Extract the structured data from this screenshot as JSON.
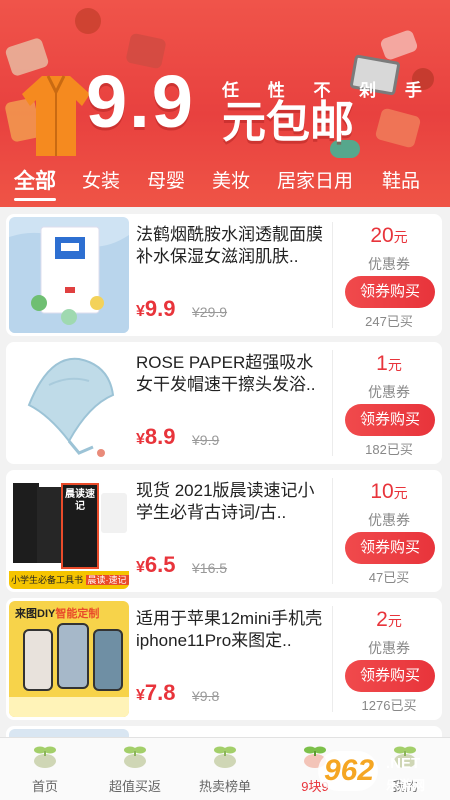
{
  "banner": {
    "big_price": "9.9",
    "slogan": "任 性 不 剁 手",
    "headline": "元包邮"
  },
  "categories": [
    {
      "label": "全部",
      "active": true
    },
    {
      "label": "女装",
      "active": false
    },
    {
      "label": "母婴",
      "active": false
    },
    {
      "label": "美妆",
      "active": false
    },
    {
      "label": "居家日用",
      "active": false
    },
    {
      "label": "鞋品",
      "active": false
    }
  ],
  "products": [
    {
      "title": "法鹤烟酰胺水润透靓面膜补水保湿女滋润肌肤..",
      "price_symbol": "¥",
      "price": "9.9",
      "original_price": "¥29.9",
      "coupon_amount": "20",
      "coupon_unit": "元",
      "coupon_label": "优惠券",
      "button_label": "领券购买",
      "sold": "247已买"
    },
    {
      "title": "ROSE PAPER超强吸水女干发帽速干擦头发浴..",
      "price_symbol": "¥",
      "price": "8.9",
      "original_price": "¥9.9",
      "coupon_amount": "1",
      "coupon_unit": "元",
      "coupon_label": "优惠券",
      "button_label": "领券购买",
      "sold": "182已买"
    },
    {
      "title": "现货 2021版晨读速记小学生必背古诗词/古..",
      "price_symbol": "¥",
      "price": "6.5",
      "original_price": "¥16.5",
      "coupon_amount": "10",
      "coupon_unit": "元",
      "coupon_label": "优惠券",
      "button_label": "领券购买",
      "sold": "47已买",
      "thumb_text": [
        "晨读速记",
        "小学生必备工具书",
        "晨读·速记"
      ]
    },
    {
      "title": "适用于苹果12mini手机壳iphone11Pro来图定..",
      "price_symbol": "¥",
      "price": "7.8",
      "original_price": "¥9.8",
      "coupon_amount": "2",
      "coupon_unit": "元",
      "coupon_label": "优惠券",
      "button_label": "领券购买",
      "sold": "1276已买",
      "thumb_text": [
        "来图DIY",
        "智能定制"
      ]
    }
  ],
  "tabbar": [
    {
      "label": "首页",
      "icon": "sprout-icon",
      "active": false
    },
    {
      "label": "超值买返",
      "icon": "sprout-icon",
      "active": false
    },
    {
      "label": "热卖榜单",
      "icon": "sprout-icon",
      "active": false
    },
    {
      "label": "9块9",
      "icon": "sprout-icon",
      "active": true
    },
    {
      "label": "我的",
      "icon": "sprout-icon",
      "active": false
    }
  ],
  "watermark": {
    "text": "962",
    "suffix": ".NET",
    "sub": "乐游网"
  },
  "colors": {
    "accent": "#e8343b",
    "banner": "#ea4540"
  }
}
